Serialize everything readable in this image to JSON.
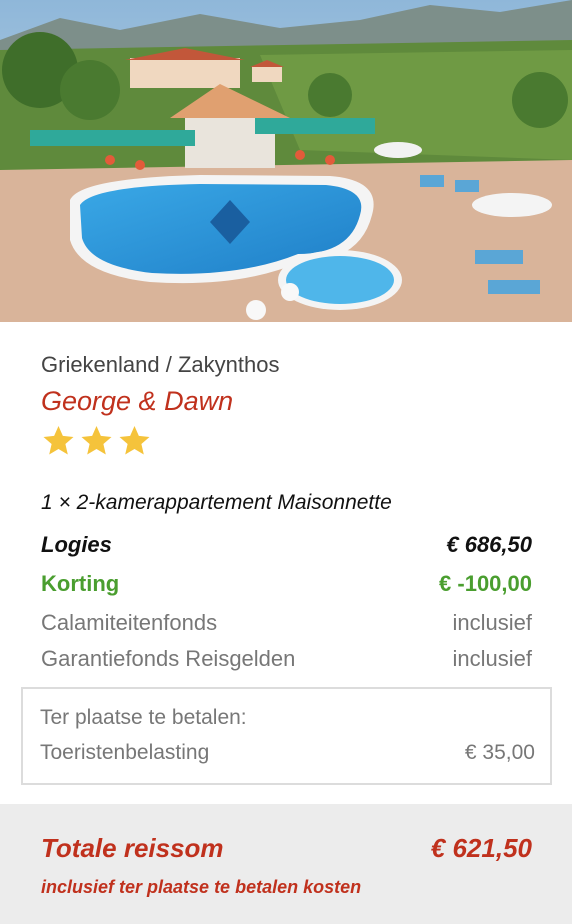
{
  "hero": {
    "image": "hotel-pool-photo"
  },
  "header": {
    "location": "Griekenland / Zakynthos",
    "hotel_name": "George & Dawn",
    "star_rating": 3,
    "star_color": "#f5c33b"
  },
  "booking": {
    "room": "1 × 2-kamerappartement Maisonnette",
    "lines": [
      {
        "label": "Logies",
        "value": "€ 686,50"
      },
      {
        "label": "Korting",
        "value": "€ -100,00"
      },
      {
        "label": "Calamiteitenfonds",
        "value": "inclusief"
      },
      {
        "label": "Garantiefonds Reisgelden",
        "value": "inclusief"
      }
    ]
  },
  "on_site": {
    "title": "Ter plaatse te betalen:",
    "label": "Toeristenbelasting",
    "value": "€ 35,00"
  },
  "total": {
    "label": "Totale reissom",
    "value": "€ 621,50",
    "note": "inclusief ter plaatse te betalen kosten"
  },
  "colors": {
    "accent_red": "#c0311d",
    "discount_green": "#4a9e2f",
    "footer_bg": "#ececec"
  }
}
